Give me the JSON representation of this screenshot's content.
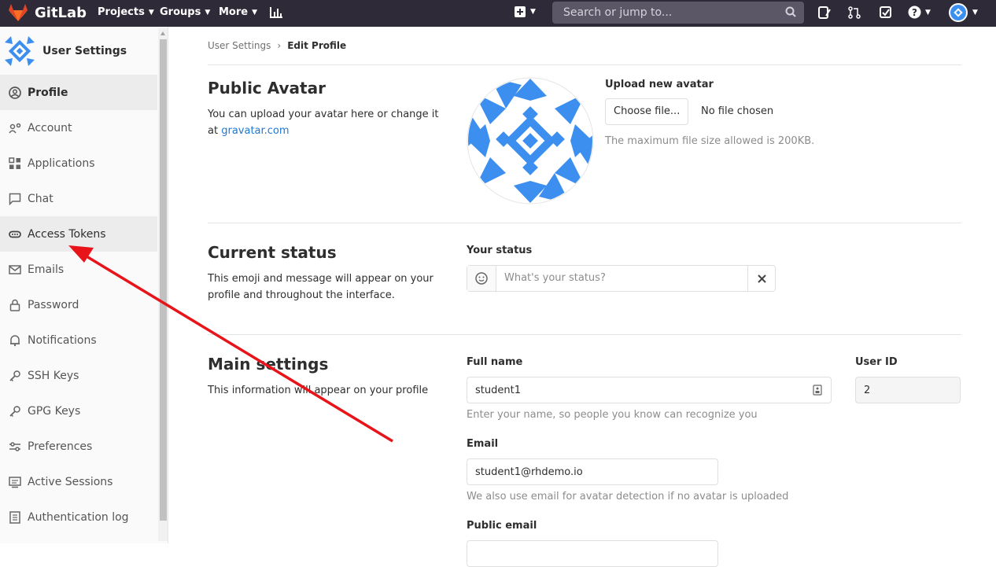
{
  "topbar": {
    "app_name": "GitLab",
    "nav": [
      "Projects",
      "Groups",
      "More"
    ],
    "search_placeholder": "Search or jump to..."
  },
  "sidebar": {
    "title": "User Settings",
    "items": [
      {
        "label": "Profile",
        "icon": "profile-icon"
      },
      {
        "label": "Account",
        "icon": "account-icon"
      },
      {
        "label": "Applications",
        "icon": "applications-icon"
      },
      {
        "label": "Chat",
        "icon": "chat-icon"
      },
      {
        "label": "Access Tokens",
        "icon": "token-icon"
      },
      {
        "label": "Emails",
        "icon": "mail-icon"
      },
      {
        "label": "Password",
        "icon": "lock-icon"
      },
      {
        "label": "Notifications",
        "icon": "bell-icon"
      },
      {
        "label": "SSH Keys",
        "icon": "key-icon"
      },
      {
        "label": "GPG Keys",
        "icon": "key-icon"
      },
      {
        "label": "Preferences",
        "icon": "preferences-icon"
      },
      {
        "label": "Active Sessions",
        "icon": "sessions-icon"
      },
      {
        "label": "Authentication log",
        "icon": "log-icon"
      }
    ]
  },
  "breadcrumb": {
    "parent": "User Settings",
    "current": "Edit Profile"
  },
  "avatar_section": {
    "title": "Public Avatar",
    "desc": "You can upload your avatar here or change it at",
    "link": "gravatar.com",
    "upload_label": "Upload new avatar",
    "choose_button": "Choose file...",
    "no_file": "No file chosen",
    "help": "The maximum file size allowed is 200KB."
  },
  "status_section": {
    "title": "Current status",
    "desc": "This emoji and message will appear on your profile and throughout the interface.",
    "label": "Your status",
    "placeholder": "What's your status?"
  },
  "main_section": {
    "title": "Main settings",
    "desc": "This information will appear on your profile",
    "full_name_label": "Full name",
    "full_name_value": "student1",
    "full_name_help": "Enter your name, so people you know can recognize you",
    "user_id_label": "User ID",
    "user_id_value": "2",
    "email_label": "Email",
    "email_value": "student1@rhdemo.io",
    "email_help": "We also use email for avatar detection if no avatar is uploaded",
    "public_email_label": "Public email"
  },
  "colors": {
    "topbar": "#2f2a38",
    "accent": "#1f78d1",
    "annotation": "#e8141a",
    "avatar": "#3d8fef"
  }
}
